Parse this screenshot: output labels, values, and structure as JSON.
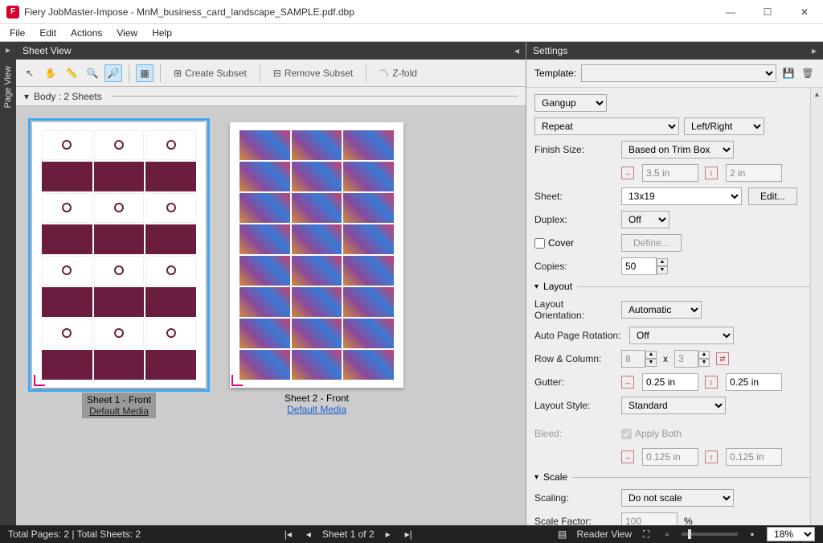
{
  "window": {
    "title": "Fiery JobMaster-Impose - MnM_business_card_landscape_SAMPLE.pdf.dbp",
    "app_glyph": "F"
  },
  "menubar": [
    "File",
    "Edit",
    "Actions",
    "View",
    "Help"
  ],
  "left_rail": {
    "tab": "Page View"
  },
  "sheetview": {
    "header": "Sheet View",
    "toolbar": {
      "create_subset": "Create Subset",
      "remove_subset": "Remove Subset",
      "zfold": "Z-fold"
    },
    "body_label": "Body : 2 Sheets",
    "sheets": [
      {
        "title": "Sheet 1 - Front",
        "media": "Default Media",
        "selected": true
      },
      {
        "title": "Sheet 2 - Front",
        "media": "Default Media",
        "selected": false
      }
    ]
  },
  "settings": {
    "header": "Settings",
    "template_label": "Template:",
    "mode": "Gangup",
    "style": "Repeat",
    "orient_toggle": "Left/Right",
    "finish_size": {
      "label": "Finish Size:",
      "value": "Based on Trim Box",
      "w": "3.5 in",
      "h": "2 in"
    },
    "sheet": {
      "label": "Sheet:",
      "value": "13x19",
      "edit": "Edit..."
    },
    "duplex": {
      "label": "Duplex:",
      "value": "Off"
    },
    "cover": {
      "label": "Cover",
      "define": "Define..."
    },
    "copies": {
      "label": "Copies:",
      "value": "50"
    },
    "layout": {
      "section": "Layout",
      "orientation": {
        "label": "Layout Orientation:",
        "value": "Automatic"
      },
      "autorot": {
        "label": "Auto Page Rotation:",
        "value": "Off"
      },
      "rowcol": {
        "label": "Row & Column:",
        "rows": "8",
        "cols": "3",
        "x": "x"
      },
      "gutter": {
        "label": "Gutter:",
        "w": "0.25 in",
        "h": "0.25 in"
      },
      "style": {
        "label": "Layout Style:",
        "value": "Standard"
      },
      "bleed": {
        "label": "Bleed:",
        "apply": "Apply Both",
        "w": "0.125 in",
        "h": "0.125 in"
      }
    },
    "scale": {
      "section": "Scale",
      "scaling": {
        "label": "Scaling:",
        "value": "Do not scale"
      },
      "factor": {
        "label": "Scale Factor:",
        "value": "100",
        "pct": "%"
      }
    }
  },
  "statusbar": {
    "left": "Total Pages: 2 | Total Sheets: 2",
    "center": "Sheet 1 of 2",
    "reader": "Reader View",
    "zoom": "18%"
  }
}
